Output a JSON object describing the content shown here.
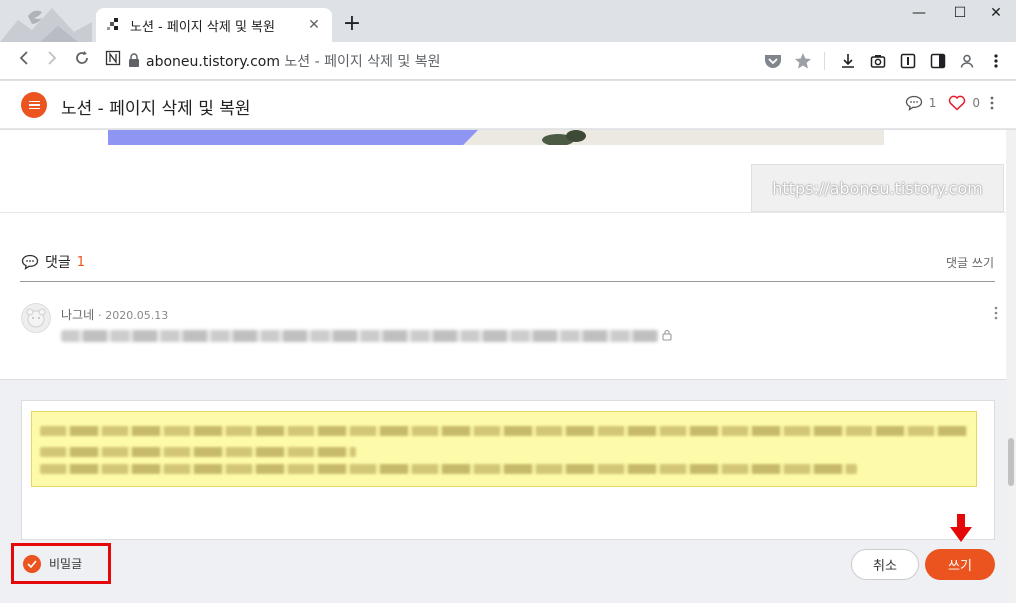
{
  "browser": {
    "tab_title": "노션 - 페이지 삭제 및 복원",
    "url_host": "aboneu.tistory.com",
    "url_path": "노션 - 페이지 삭제 및 복원",
    "new_tab": "+",
    "close_tab": "✕",
    "minimize": "—",
    "maximize": "☐",
    "close_window": "✕"
  },
  "header": {
    "title": "노션 - 페이지 삭제 및 복원",
    "comment_count": "1",
    "like_count": "0"
  },
  "article": {
    "watermark": "https://aboneu.tistory.com"
  },
  "comments": {
    "heading": "댓글",
    "count": "1",
    "write_link": "댓글 쓰기",
    "items": [
      {
        "author": "나그네",
        "separator": "·",
        "date": "2020.05.13"
      }
    ]
  },
  "form": {
    "secret_label": "비밀글",
    "cancel_label": "취소",
    "submit_label": "쓰기"
  },
  "colors": {
    "accent": "#eb531f",
    "highlight_box": "#e5080b"
  }
}
